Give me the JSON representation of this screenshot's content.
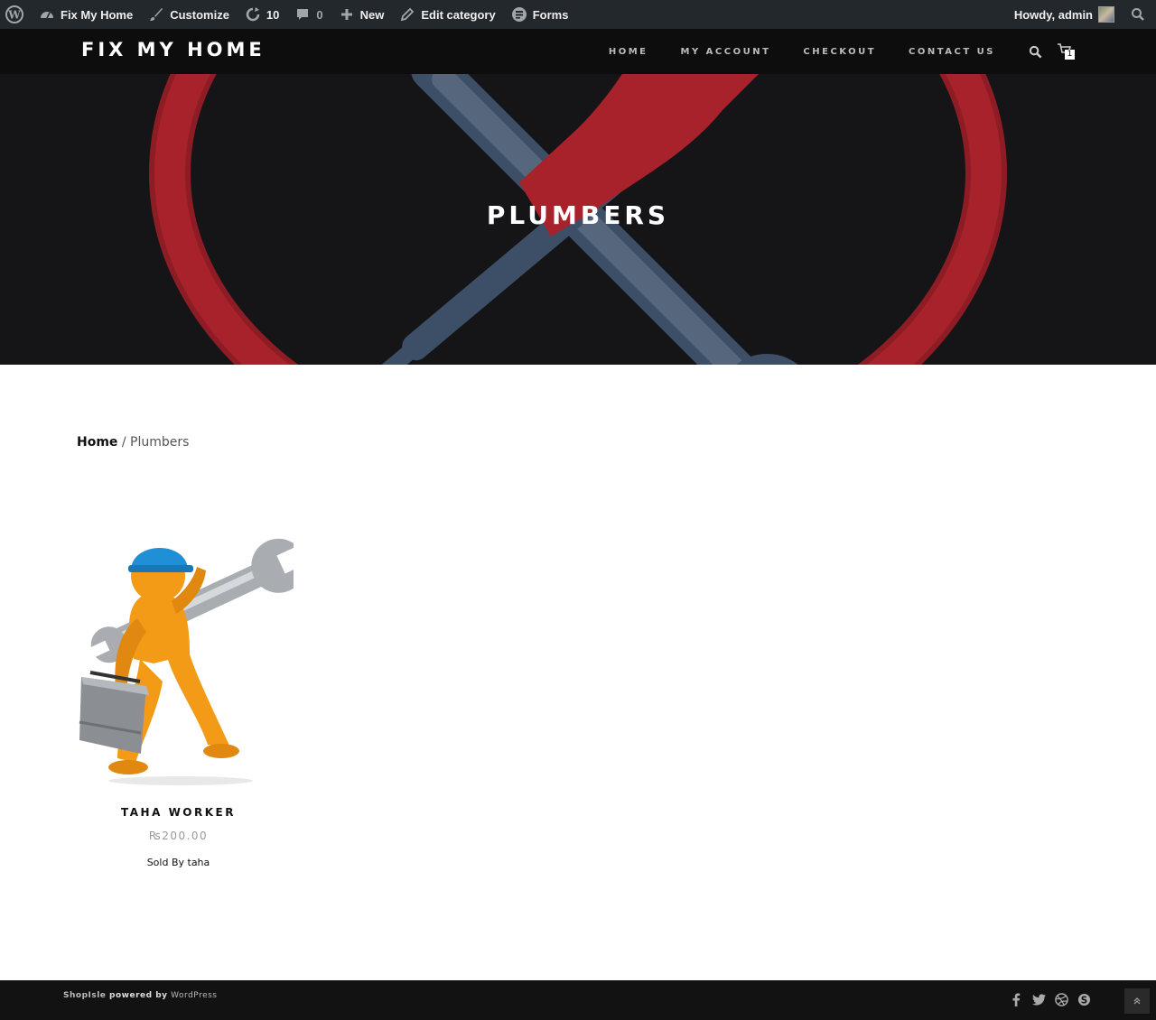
{
  "adminbar": {
    "site_name": "Fix My Home",
    "customize": "Customize",
    "updates_count": "10",
    "comments_count": "0",
    "new_label": "New",
    "edit_label": "Edit category",
    "forms_label": "Forms",
    "howdy": "Howdy, admin"
  },
  "header": {
    "logo": "FIX MY HOME",
    "nav": [
      "HOME",
      "MY ACCOUNT",
      "CHECKOUT",
      "CONTACT US"
    ],
    "cart_count": "1"
  },
  "hero": {
    "title": "PLUMBERS"
  },
  "breadcrumb": {
    "home": "Home",
    "separator": " / ",
    "current": "Plumbers"
  },
  "products": [
    {
      "title": "TAHA WORKER",
      "price": "₨200.00",
      "vendor": "Sold By taha"
    }
  ],
  "footer": {
    "theme": "ShopIsle",
    "powered": " powered by ",
    "platform": "WordPress"
  },
  "colors": {
    "adminbar_bg": "#23282d",
    "header_bg": "#0d0d0d",
    "accent_red": "#a8222b",
    "tool_blue": "#3d4f66"
  }
}
